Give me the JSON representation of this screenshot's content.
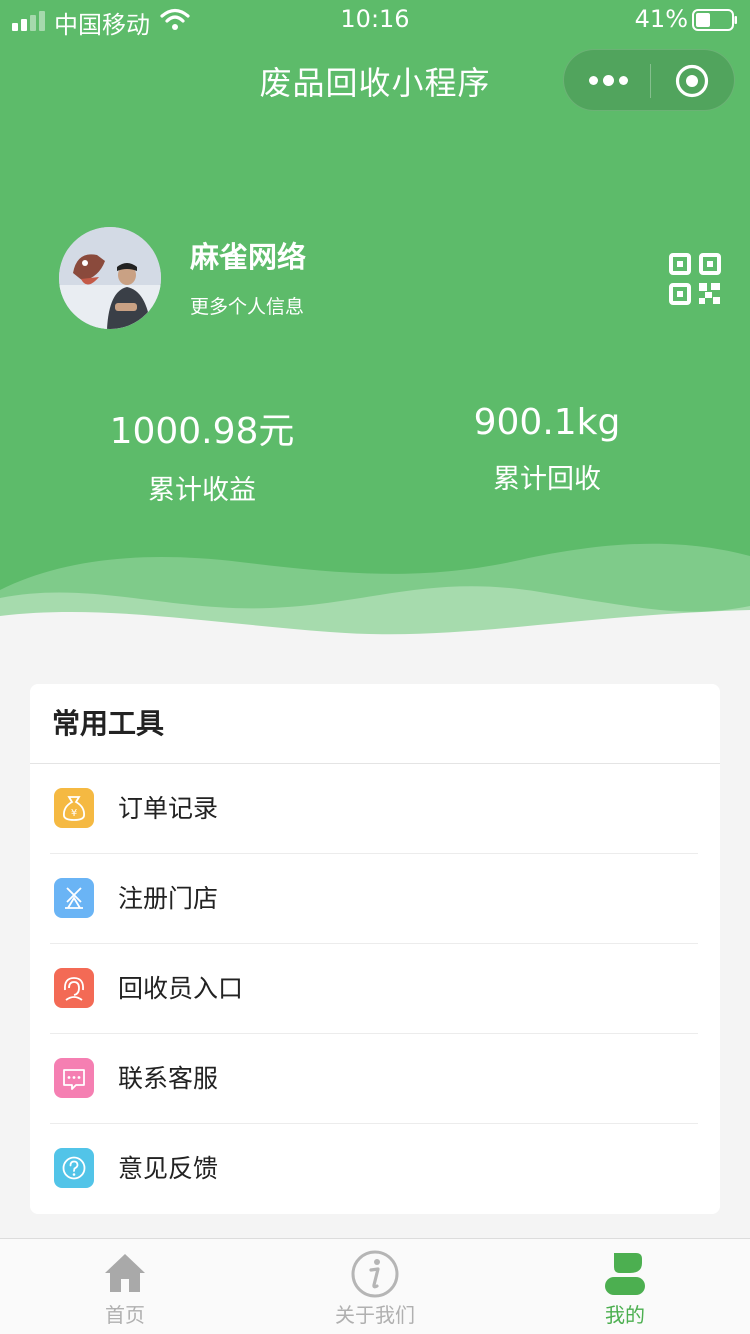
{
  "status_bar": {
    "carrier": "中国移动",
    "time": "10:16",
    "battery": "41%"
  },
  "navbar": {
    "title": "废品回收小程序"
  },
  "profile": {
    "name": "麻雀网络",
    "more_info": "更多个人信息",
    "avatar_text": "麻雀网络"
  },
  "stats": {
    "income_value": "1000.98元",
    "income_label": "累计收益",
    "recycle_value": "900.1kg",
    "recycle_label": "累计回收"
  },
  "tools": {
    "title": "常用工具",
    "items": [
      {
        "label": "订单记录",
        "icon": "money-bag-icon",
        "color": "#f5b942"
      },
      {
        "label": "注册门店",
        "icon": "store-icon",
        "color": "#6ab4f5"
      },
      {
        "label": "回收员入口",
        "icon": "headset-icon",
        "color": "#f36a55"
      },
      {
        "label": "联系客服",
        "icon": "chat-icon",
        "color": "#f57fb2"
      },
      {
        "label": "意见反馈",
        "icon": "question-icon",
        "color": "#52c4e8"
      }
    ]
  },
  "tabbar": {
    "tabs": [
      {
        "label": "首页",
        "icon": "home-icon"
      },
      {
        "label": "关于我们",
        "icon": "info-icon"
      },
      {
        "label": "我的",
        "icon": "user-icon",
        "active": true
      }
    ]
  },
  "colors": {
    "primary": "#5dbb6a",
    "active_tab": "#4caf50",
    "background": "#f4f4f4"
  }
}
